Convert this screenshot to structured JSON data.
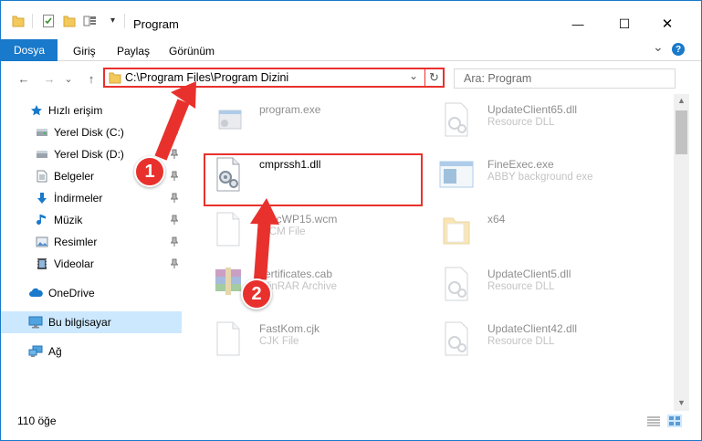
{
  "window": {
    "title": "Program",
    "minimize_glyph": "—",
    "maximize_glyph": "☐",
    "close_glyph": "✕"
  },
  "ribbon": {
    "tabs": [
      "Dosya",
      "Giriş",
      "Paylaş",
      "Görünüm"
    ],
    "expand_glyph": "⌄",
    "help_glyph": "?"
  },
  "navigation": {
    "back_glyph": "←",
    "forward_glyph": "→",
    "dropdown_glyph": "⌄",
    "up_glyph": "↑",
    "address": "C:\\Program Files\\Program Dizini",
    "address_dropdown_glyph": "⌄",
    "refresh_glyph": "↻",
    "search_placeholder": "Ara: Program"
  },
  "sidebar": {
    "items": [
      {
        "label": "Hızlı erişim",
        "icon": "star-icon",
        "pinned": false
      },
      {
        "label": "Yerel Disk (C:)",
        "icon": "drive-icon",
        "pinned": true
      },
      {
        "label": "Yerel Disk (D:)",
        "icon": "drive-icon",
        "pinned": true
      },
      {
        "label": "Belgeler",
        "icon": "document-icon",
        "pinned": true
      },
      {
        "label": "İndirmeler",
        "icon": "download-icon",
        "pinned": true
      },
      {
        "label": "Müzik",
        "icon": "music-icon",
        "pinned": true
      },
      {
        "label": "Resimler",
        "icon": "pictures-icon",
        "pinned": true
      },
      {
        "label": "Videolar",
        "icon": "video-icon",
        "pinned": true
      },
      {
        "label": "OneDrive",
        "icon": "cloud-icon",
        "pinned": false
      },
      {
        "label": "Bu bilgisayar",
        "icon": "computer-icon",
        "pinned": false,
        "selected": true
      },
      {
        "label": "Ağ",
        "icon": "network-icon",
        "pinned": false
      }
    ]
  },
  "files": [
    {
      "name": "program.exe",
      "type": "",
      "icon": "exe-icon"
    },
    {
      "name": "UpdateClient65.dll",
      "type": "Resource DLL",
      "icon": "dll-icon"
    },
    {
      "name": "cmprssh1.dll",
      "type": "",
      "icon": "dll-gear-icon",
      "highlighted": true
    },
    {
      "name": "FineExec.exe",
      "type": "ABBY background exe",
      "icon": "app-window-icon"
    },
    {
      "name": "RetcWP15.wcm",
      "type": "WCM File",
      "icon": "blank-file-icon"
    },
    {
      "name": "x64",
      "type": "",
      "icon": "folder-icon"
    },
    {
      "name": "certificates.cab",
      "type": "WinRAR Archive",
      "icon": "archive-icon"
    },
    {
      "name": "UpdateClient5.dll",
      "type": "Resource DLL",
      "icon": "dll-icon"
    },
    {
      "name": "FastKom.cjk",
      "type": "CJK File",
      "icon": "blank-file-icon"
    },
    {
      "name": "UpdateClient42.dll",
      "type": "Resource DLL",
      "icon": "dll-icon"
    }
  ],
  "status": {
    "item_count": "110 öğe"
  },
  "annotations": {
    "step1": "1",
    "step2": "2"
  },
  "colors": {
    "accent": "#1979ca",
    "annotation": "#e8312d",
    "selected_bg": "#cce8ff"
  }
}
